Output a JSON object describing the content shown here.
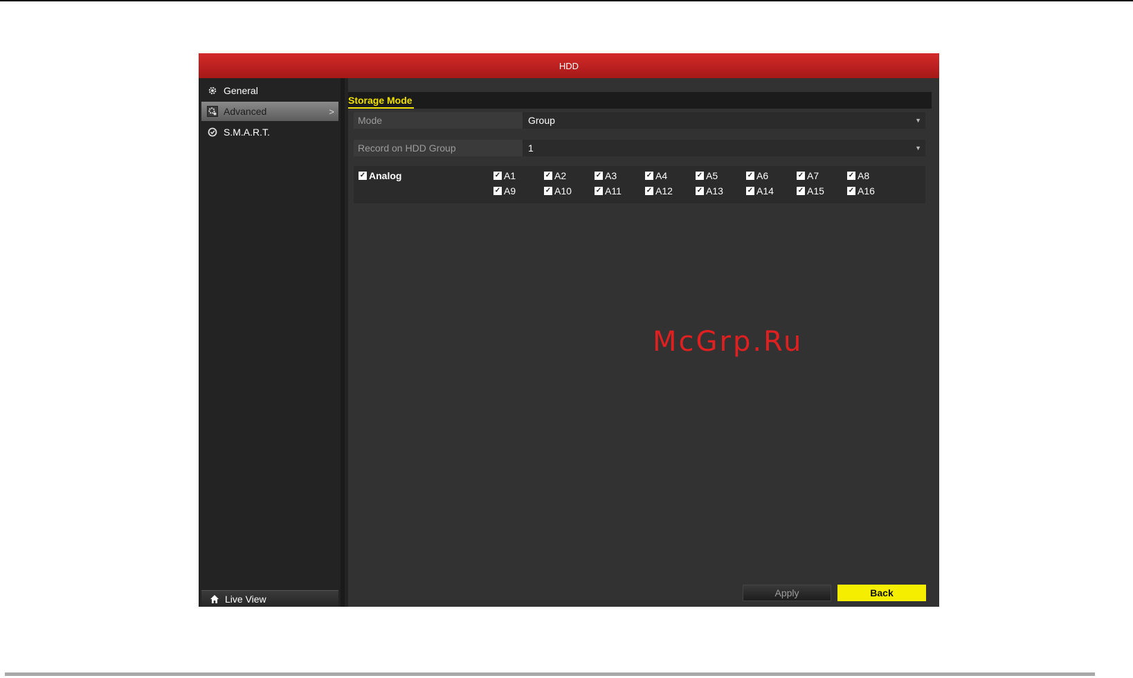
{
  "window": {
    "title": "HDD"
  },
  "sidebar": {
    "items": [
      {
        "label": "General",
        "icon": "gear-icon"
      },
      {
        "label": "Advanced",
        "icon": "advanced-gear-icon",
        "active": true,
        "chevron": ">"
      },
      {
        "label": "S.M.A.R.T.",
        "icon": "shield-icon"
      }
    ],
    "live_view": {
      "label": "Live View",
      "icon": "home-icon"
    }
  },
  "content": {
    "section_tab": "Storage Mode",
    "mode": {
      "label": "Mode",
      "value": "Group"
    },
    "hdd_group": {
      "label": "Record on HDD Group",
      "value": "1"
    },
    "analog": {
      "label": "Analog",
      "checked": true
    },
    "channels": [
      "A1",
      "A2",
      "A3",
      "A4",
      "A5",
      "A6",
      "A7",
      "A8",
      "A9",
      "A10",
      "A11",
      "A12",
      "A13",
      "A14",
      "A15",
      "A16"
    ]
  },
  "buttons": {
    "apply": "Apply",
    "back": "Back"
  },
  "watermark": "McGrp.Ru",
  "colors": {
    "title_bar": "#c41f1f",
    "accent_yellow": "#f6ee00",
    "panel": "#323232"
  }
}
